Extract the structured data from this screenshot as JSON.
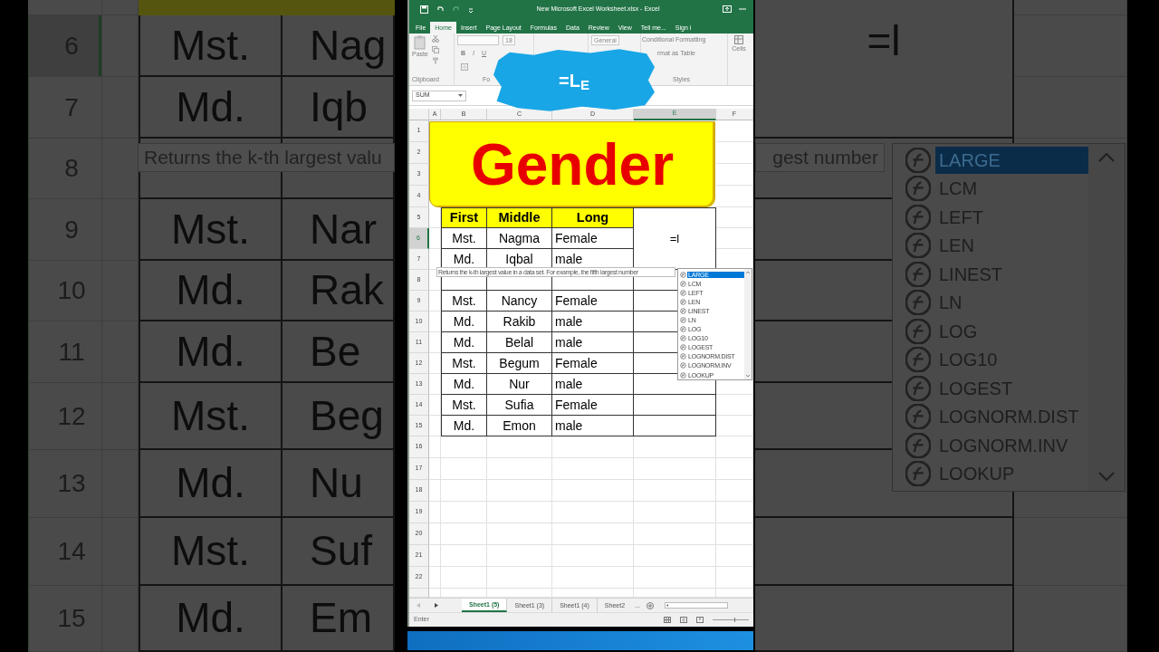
{
  "backdrop_left": {
    "rows": [
      {
        "number": "6",
        "selected": true,
        "cells": [
          "Mst.",
          "Nag"
        ]
      },
      {
        "number": "7",
        "selected": false,
        "cells": [
          "Md.",
          "Iqb"
        ]
      },
      {
        "number": "8",
        "selected": false
      },
      {
        "number": "9",
        "selected": false,
        "cells": [
          "Mst.",
          "Nar"
        ]
      },
      {
        "number": "10",
        "selected": false,
        "cells": [
          "Md.",
          "Rak"
        ]
      },
      {
        "number": "11",
        "selected": false,
        "cells": [
          "Md.",
          "Be"
        ]
      },
      {
        "number": "12",
        "selected": false,
        "cells": [
          "Mst.",
          "Beg"
        ]
      },
      {
        "number": "13",
        "selected": false,
        "cells": [
          "Md.",
          "Nu"
        ]
      },
      {
        "number": "14",
        "selected": false,
        "cells": [
          "Mst.",
          "Suf"
        ]
      },
      {
        "number": "15",
        "selected": false,
        "cells": [
          "Md.",
          "Em"
        ]
      }
    ],
    "tooltip": "Returns the k-th largest valu"
  },
  "backdrop_right": {
    "editing_cell": "=l",
    "tooltip": "gest number",
    "autocomplete": [
      {
        "label": "LARGE",
        "selected": true
      },
      {
        "label": "LCM",
        "selected": false
      },
      {
        "label": "LEFT",
        "selected": false
      },
      {
        "label": "LEN",
        "selected": false
      },
      {
        "label": "LINEST",
        "selected": false
      },
      {
        "label": "LN",
        "selected": false
      },
      {
        "label": "LOG",
        "selected": false
      },
      {
        "label": "LOG10",
        "selected": false
      },
      {
        "label": "LOGEST",
        "selected": false
      },
      {
        "label": "LOGNORM.DIST",
        "selected": false
      },
      {
        "label": "LOGNORM.INV",
        "selected": false
      },
      {
        "label": "LOOKUP",
        "selected": false
      }
    ]
  },
  "title_bar": {
    "title": "New Microsoft Excel Worksheet.xlsx - Excel"
  },
  "tabs": [
    {
      "label": "File",
      "selected": false
    },
    {
      "label": "Home",
      "selected": true
    },
    {
      "label": "Insert",
      "selected": false
    },
    {
      "label": "Page Layout",
      "selected": false
    },
    {
      "label": "Formulas",
      "selected": false
    },
    {
      "label": "Data",
      "selected": false
    },
    {
      "label": "Review",
      "selected": false
    },
    {
      "label": "View",
      "selected": false
    },
    {
      "label": "Tell me...",
      "selected": false
    },
    {
      "label": "Sign i",
      "selected": false
    }
  ],
  "ribbon": {
    "paste": "Paste",
    "clipboard_label": "Clipboard",
    "font_size": "18",
    "bold": "B",
    "italic": "I",
    "underline": "U",
    "font_label": "Fo",
    "number_format": "General",
    "conditional_formatting": "Conditional Formatting",
    "format_as_table": "rmat as Table",
    "styles_label": "Styles",
    "cells_label": "Cells"
  },
  "overlay": {
    "text": "=L$_{E}$"
  },
  "formula_bar": {
    "name_box": "SUM"
  },
  "sheet": {
    "column_letters": [
      {
        "label": "A",
        "selected": false
      },
      {
        "label": "B",
        "selected": false
      },
      {
        "label": "C",
        "selected": false
      },
      {
        "label": "D",
        "selected": false
      },
      {
        "label": "E",
        "selected": true
      },
      {
        "label": "F",
        "selected": false
      }
    ],
    "row_numbers": [
      {
        "label": "1",
        "selected": false
      },
      {
        "label": "2",
        "selected": false
      },
      {
        "label": "3",
        "selected": false
      },
      {
        "label": "4",
        "selected": false
      },
      {
        "label": "5",
        "selected": false
      },
      {
        "label": "6",
        "selected": true
      },
      {
        "label": "7",
        "selected": false
      },
      {
        "label": "8",
        "selected": false
      },
      {
        "label": "9",
        "selected": false
      },
      {
        "label": "10",
        "selected": false
      },
      {
        "label": "11",
        "selected": false
      },
      {
        "label": "12",
        "selected": false
      },
      {
        "label": "13",
        "selected": false
      },
      {
        "label": "14",
        "selected": false
      },
      {
        "label": "15",
        "selected": false
      },
      {
        "label": "16",
        "selected": false
      },
      {
        "label": "17",
        "selected": false
      },
      {
        "label": "18",
        "selected": false
      },
      {
        "label": "19",
        "selected": false
      },
      {
        "label": "20",
        "selected": false
      },
      {
        "label": "21",
        "selected": false
      },
      {
        "label": "22",
        "selected": false
      }
    ],
    "banner": "Gender",
    "header": [
      "First",
      "Middle",
      "Long"
    ],
    "rows_above_tooltip": [
      [
        "Mst.",
        "Nagma",
        "Female"
      ],
      [
        "Md.",
        "Iqbal",
        "male"
      ]
    ],
    "rows_below_tooltip": [
      [
        "Mst.",
        "Nancy",
        "Female"
      ],
      [
        "Md.",
        "Rakib",
        "male"
      ],
      [
        "Md.",
        "Belal",
        "male"
      ],
      [
        "Mst.",
        "Begum",
        "Female"
      ],
      [
        "Md.",
        "Nur",
        "male"
      ],
      [
        "Mst.",
        "Sufia",
        "Female"
      ],
      [
        "Md.",
        "Emon",
        "male"
      ]
    ],
    "editing_cell": "=l",
    "tooltip": "Returns the k-th largest value in a data set. For example, the fifth largest number",
    "autocomplete": [
      {
        "label": "LARGE",
        "selected": true
      },
      {
        "label": "LCM",
        "selected": false
      },
      {
        "label": "LEFT",
        "selected": false
      },
      {
        "label": "LEN",
        "selected": false
      },
      {
        "label": "LINEST",
        "selected": false
      },
      {
        "label": "LN",
        "selected": false
      },
      {
        "label": "LOG",
        "selected": false
      },
      {
        "label": "LOG10",
        "selected": false
      },
      {
        "label": "LOGEST",
        "selected": false
      },
      {
        "label": "LOGNORM.DIST",
        "selected": false
      },
      {
        "label": "LOGNORM.INV",
        "selected": false
      },
      {
        "label": "LOOKUP",
        "selected": false
      }
    ]
  },
  "sheet_tabs": [
    {
      "label": "Sheet1 (5)",
      "selected": true
    },
    {
      "label": "Sheet1 (3)",
      "selected": false
    },
    {
      "label": "Sheet1 (4)",
      "selected": false
    },
    {
      "label": "Sheet2",
      "selected": false
    }
  ],
  "more_tabs": "...",
  "status_bar": {
    "mode": "Enter",
    "zoom": {
      "level": 0.6
    }
  }
}
